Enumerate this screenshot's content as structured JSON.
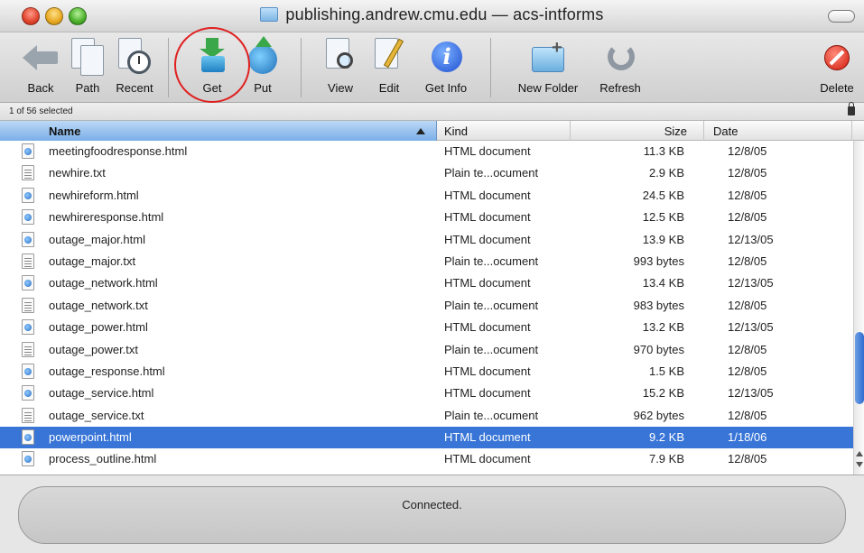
{
  "window": {
    "title": "publishing.andrew.cmu.edu — acs-intforms"
  },
  "toolbar": {
    "buttons": [
      {
        "id": "back",
        "label": "Back",
        "icon": "back-arrow-icon"
      },
      {
        "id": "path",
        "label": "Path",
        "icon": "path-icon"
      },
      {
        "id": "recent",
        "label": "Recent",
        "icon": "clock-icon"
      },
      {
        "id": "get",
        "label": "Get",
        "icon": "download-icon"
      },
      {
        "id": "put",
        "label": "Put",
        "icon": "upload-globe-icon"
      },
      {
        "id": "view",
        "label": "View",
        "icon": "magnifier-icon"
      },
      {
        "id": "edit",
        "label": "Edit",
        "icon": "pencil-icon"
      },
      {
        "id": "getinfo",
        "label": "Get Info",
        "icon": "info-icon"
      },
      {
        "id": "newfolder",
        "label": "New Folder",
        "icon": "new-folder-icon"
      },
      {
        "id": "refresh",
        "label": "Refresh",
        "icon": "refresh-icon"
      },
      {
        "id": "delete",
        "label": "Delete",
        "icon": "delete-icon"
      }
    ],
    "highlight_color": "#e02020"
  },
  "status": {
    "selection": "1 of 56 selected"
  },
  "table": {
    "headers": {
      "name": "Name",
      "kind": "Kind",
      "size": "Size",
      "date": "Date"
    },
    "rows": [
      {
        "name": "meetingfoodresponse.html",
        "kind": "HTML document",
        "size": "11.3 KB",
        "date": "12/8/05",
        "type": "html",
        "selected": false
      },
      {
        "name": "newhire.txt",
        "kind": "Plain te...ocument",
        "size": "2.9 KB",
        "date": "12/8/05",
        "type": "txt",
        "selected": false
      },
      {
        "name": "newhireform.html",
        "kind": "HTML document",
        "size": "24.5 KB",
        "date": "12/8/05",
        "type": "html",
        "selected": false
      },
      {
        "name": "newhireresponse.html",
        "kind": "HTML document",
        "size": "12.5 KB",
        "date": "12/8/05",
        "type": "html",
        "selected": false
      },
      {
        "name": "outage_major.html",
        "kind": "HTML document",
        "size": "13.9 KB",
        "date": "12/13/05",
        "type": "html",
        "selected": false
      },
      {
        "name": "outage_major.txt",
        "kind": "Plain te...ocument",
        "size": "993 bytes",
        "date": "12/8/05",
        "type": "txt",
        "selected": false
      },
      {
        "name": "outage_network.html",
        "kind": "HTML document",
        "size": "13.4 KB",
        "date": "12/13/05",
        "type": "html",
        "selected": false
      },
      {
        "name": "outage_network.txt",
        "kind": "Plain te...ocument",
        "size": "983 bytes",
        "date": "12/8/05",
        "type": "txt",
        "selected": false
      },
      {
        "name": "outage_power.html",
        "kind": "HTML document",
        "size": "13.2 KB",
        "date": "12/13/05",
        "type": "html",
        "selected": false
      },
      {
        "name": "outage_power.txt",
        "kind": "Plain te...ocument",
        "size": "970 bytes",
        "date": "12/8/05",
        "type": "txt",
        "selected": false
      },
      {
        "name": "outage_response.html",
        "kind": "HTML document",
        "size": "1.5 KB",
        "date": "12/8/05",
        "type": "html",
        "selected": false
      },
      {
        "name": "outage_service.html",
        "kind": "HTML document",
        "size": "15.2 KB",
        "date": "12/13/05",
        "type": "html",
        "selected": false
      },
      {
        "name": "outage_service.txt",
        "kind": "Plain te...ocument",
        "size": "962 bytes",
        "date": "12/8/05",
        "type": "txt",
        "selected": false
      },
      {
        "name": "powerpoint.html",
        "kind": "HTML document",
        "size": "9.2 KB",
        "date": "1/18/06",
        "type": "html",
        "selected": true
      },
      {
        "name": "process_outline.html",
        "kind": "HTML document",
        "size": "7.9 KB",
        "date": "12/8/05",
        "type": "html",
        "selected": false
      }
    ],
    "selection_color": "#3875d7"
  },
  "footer": {
    "connection_status": "Connected."
  }
}
